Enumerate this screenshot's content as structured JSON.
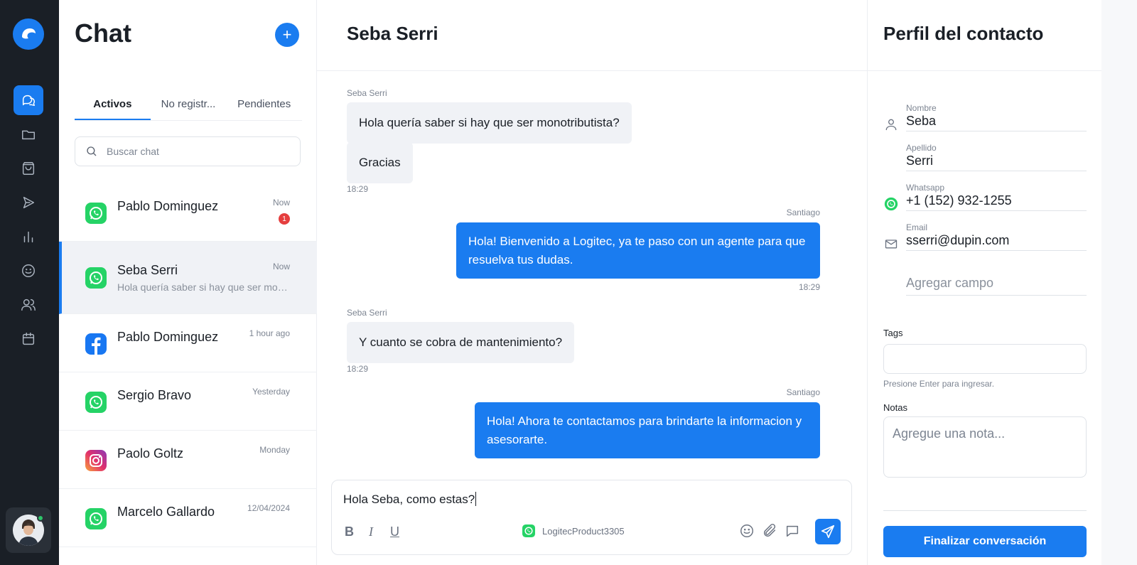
{
  "colors": {
    "accent": "#1a7cf0",
    "rail_bg": "#1a1f26",
    "whatsapp": "#25d366",
    "facebook": "#1877f2",
    "unread_badge": "#e53e3e",
    "online": "#2ec46a"
  },
  "rail": {
    "logo_icon": "brand-logo-icon",
    "nav": [
      {
        "icon": "chat-icon",
        "active": true
      },
      {
        "icon": "folder-icon"
      },
      {
        "icon": "bag-icon"
      },
      {
        "icon": "campaign-icon"
      },
      {
        "icon": "chart-icon"
      },
      {
        "icon": "smile-icon"
      },
      {
        "icon": "users-icon"
      },
      {
        "icon": "calendar-icon"
      }
    ],
    "avatar_status": "online"
  },
  "chat_list": {
    "title": "Chat",
    "new_chat_label": "+",
    "tabs": [
      {
        "label": "Activos",
        "active": true
      },
      {
        "label": "No registr..."
      },
      {
        "label": "Pendientes"
      }
    ],
    "search_placeholder": "Buscar chat",
    "items": [
      {
        "name": "Pablo Dominguez",
        "time": "Now",
        "preview": "",
        "channel": "whatsapp-icon",
        "unread": "1"
      },
      {
        "name": "Seba Serri",
        "time": "Now",
        "preview": "Hola quería saber si hay que ser mon...",
        "channel": "whatsapp-icon",
        "selected": true
      },
      {
        "name": "Pablo Dominguez",
        "time": "1 hour ago",
        "preview": "",
        "channel": "facebook-icon"
      },
      {
        "name": "Sergio Bravo",
        "time": "Yesterday",
        "preview": "",
        "channel": "whatsapp-icon"
      },
      {
        "name": "Paolo Goltz",
        "time": "Monday",
        "preview": "",
        "channel": "instagram-icon"
      },
      {
        "name": "Marcelo Gallardo",
        "time": "12/04/2024",
        "preview": "",
        "channel": "whatsapp-icon"
      }
    ]
  },
  "conversation": {
    "title": "Seba Serri",
    "messages": [
      {
        "direction": "in",
        "sender": "Seba Serri",
        "text": "Hola quería saber si hay que ser monotributista?"
      },
      {
        "direction": "in",
        "text": "Gracias",
        "time": "18:29"
      },
      {
        "direction": "out",
        "sender": "Santiago",
        "text": "Hola! Bienvenido a Logitec, ya te paso con un agente para que resuelva tus dudas.",
        "time": "18:29"
      },
      {
        "direction": "in",
        "sender": "Seba Serri",
        "text": "Y cuanto se cobra de mantenimiento?",
        "time": "18:29"
      },
      {
        "direction": "out",
        "sender": "Santiago",
        "text": "Hola! Ahora te contactamos para brindarte la informacion y asesorarte."
      }
    ],
    "composer": {
      "draft": "Hola Seba, como estas?",
      "bold": "B",
      "italic": "I",
      "underline": "U",
      "channel_account": "LogitecProduct3305"
    }
  },
  "profile": {
    "title": "Perfil del contacto",
    "fields": [
      {
        "label": "Nombre",
        "value": "Seba",
        "icon": "user-icon"
      },
      {
        "label": "Apellido",
        "value": "Serri"
      },
      {
        "label": "Whatsapp",
        "value": "+1 (152) 932-1255",
        "icon": "whatsapp-icon"
      },
      {
        "label": "Email",
        "value": "sserri@dupin.com",
        "icon": "mail-icon"
      }
    ],
    "add_field": "Agregar campo",
    "tags_label": "Tags",
    "tags_helper": "Presione Enter para ingresar.",
    "notes_label": "Notas",
    "notes_placeholder": "Agregue una nota...",
    "finish_button": "Finalizar conversación"
  }
}
